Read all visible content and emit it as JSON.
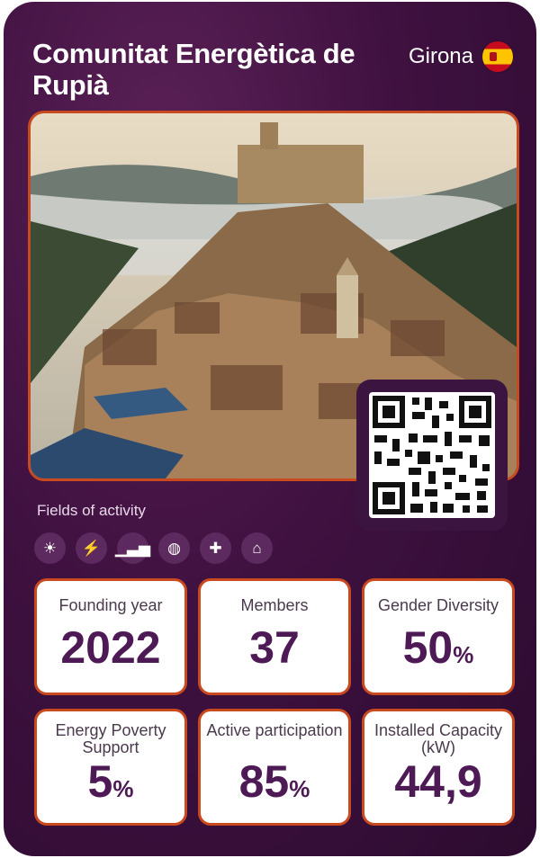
{
  "header": {
    "title": "Comunitat Energètica de Rupià",
    "region": "Girona",
    "flag_icon": "spain-flag-icon"
  },
  "fields": {
    "label": "Fields of activity",
    "icons": [
      "sun-icon",
      "lightning-icon",
      "efficiency-chart-icon",
      "globe-icon",
      "puzzle-icon",
      "home-energy-icon"
    ]
  },
  "stats": [
    {
      "label": "Founding year",
      "value": "2022",
      "unit": ""
    },
    {
      "label": "Members",
      "value": "37",
      "unit": ""
    },
    {
      "label": "Gender Diversity",
      "value": "50",
      "unit": "%"
    },
    {
      "label": "Energy Poverty Support",
      "value": "5",
      "unit": "%"
    },
    {
      "label": "Active participation",
      "value": "85",
      "unit": "%"
    },
    {
      "label": "Installed Capacity (kW)",
      "value": "44,9",
      "unit": ""
    }
  ],
  "colors": {
    "background": "#3f1140",
    "accent_border": "#c94a1e",
    "value_text": "#4e1a55"
  }
}
